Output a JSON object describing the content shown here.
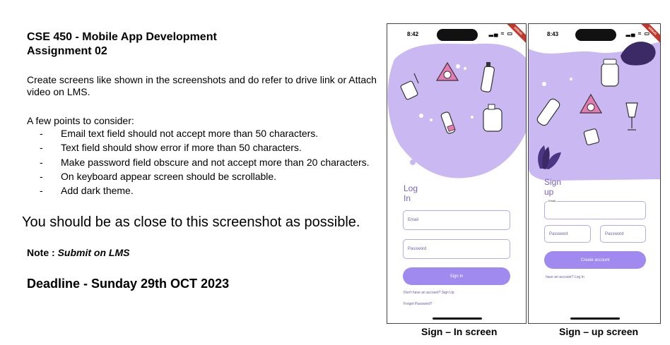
{
  "doc": {
    "title_line1": "CSE 450 - Mobile App Development",
    "title_line2": "Assignment 02",
    "description": "Create screens like shown in the screenshots and do refer to drive link or Attach video on LMS.",
    "points_heading": "A few points to consider:",
    "points": [
      "Email text field should not accept more than 50 characters.",
      "Text field should show error if more than 50 characters.",
      "Make password field obscure and not accept more than 20 characters.",
      "On keyboard appear screen should be scrollable.",
      "Add dark theme."
    ],
    "closeness": "You should be as close to this screenshot as possible.",
    "note_label": "Note : ",
    "note_value": "Submit on LMS",
    "deadline": "Deadline - Sunday 29th OCT 2023"
  },
  "login": {
    "time": "8:42",
    "status_icons": "▂▄ ≈ ▭",
    "title": "Log In",
    "email_placeholder": "Email",
    "password_placeholder": "Password",
    "button": "Sign In",
    "no_account": "Don't have an account? Sign Up",
    "forget": "Forget Password?",
    "caption": "Sign – In screen"
  },
  "signup": {
    "time": "8:43",
    "status_icons": "▂▄ ≈ ▭",
    "title": "Sign up",
    "email_label": "Email",
    "password_placeholder": "Password",
    "confirm_placeholder": "Password",
    "button": "Create account",
    "have_account": "have an account? Log In",
    "caption": "Sign – up screen"
  },
  "colors": {
    "accent": "#a08af0",
    "blob": "#c9b8f2",
    "title": "#7a62c2"
  }
}
